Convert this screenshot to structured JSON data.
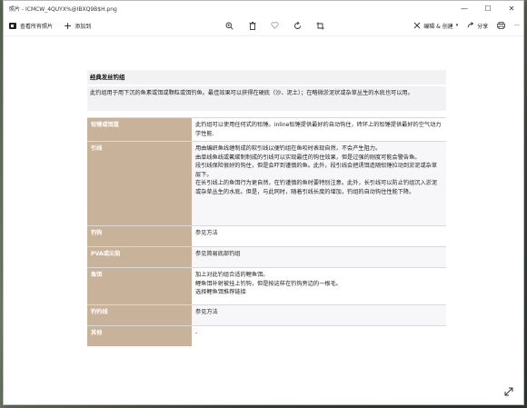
{
  "window": {
    "title": "照片 - ICMCW_4QUYX%@IBXQ9B$H.png",
    "controls": {
      "minimize": "—",
      "maximize": "☐",
      "close": "✕"
    }
  },
  "toolbar": {
    "view_all": "查看所有照片",
    "add": "添加到",
    "edit_create": "编辑 & 创建",
    "share": "分享",
    "more": "···",
    "icons": [
      "zoom-in-icon",
      "delete-icon",
      "heart-icon",
      "rotate-icon",
      "crop-icon"
    ]
  },
  "doc": {
    "heading": "经典发丝钓组",
    "intro": "此钓组用于用下沉的鱼素或饵或颗粒或饵钓鱼。最佳效果可以获得在硬底（沙、泥土）；在略微淤泥状或杂草丛生的水底也可以用。",
    "rows": [
      {
        "label": "铅锤或饵篮",
        "value": [
          "此钓组可以使用任何式的铅锤。inline铅锤提供最好的自动钩住，砖环上的铅锤提供最好的空气动力学性能."
        ]
      },
      {
        "label": "引线",
        "value": [
          "用由编织鱼线缠制成的软引线以便钓组在鱼咬时表现自然，不会产生阻力。",
          "由单线鱼线或氟碳制制成的引线可以实现最佳的钩住效果，但是过强的刚度可能会警告鱼。",
          "段引线保险很好的钩住，但是会吓到谨慎的鱼。此外，段引线会把诱饵造随铅锤拉动到淤泥或杂草层下。",
          "在长引线上的鱼饵行为更自然，在钓谨慎的鱼时要特别注意。此外，长引线可以防止钓组沉入淤泥或杂草丛生的水底。但是，与此同时，随着引线长度的增加，钓组的自动钩住性能下降。"
        ]
      },
      {
        "label": "钓钩",
        "value": [
          "参见方法"
        ]
      },
      {
        "label": "PVA或尖茄",
        "value": [
          "参见简易底部钓组"
        ]
      },
      {
        "label": "鱼饵",
        "value": [
          "加上对此钓组合适的鲤鱼饵。",
          "鲤鱼饵补射被挂上钓钩，但是按这样在钓钩旁边的一根毛。",
          "选择鲤鱼饵推荐链接"
        ]
      },
      {
        "label": "钓钓线",
        "value": [
          "参见方法"
        ]
      },
      {
        "label": "其他",
        "value": [
          "-"
        ]
      }
    ]
  }
}
